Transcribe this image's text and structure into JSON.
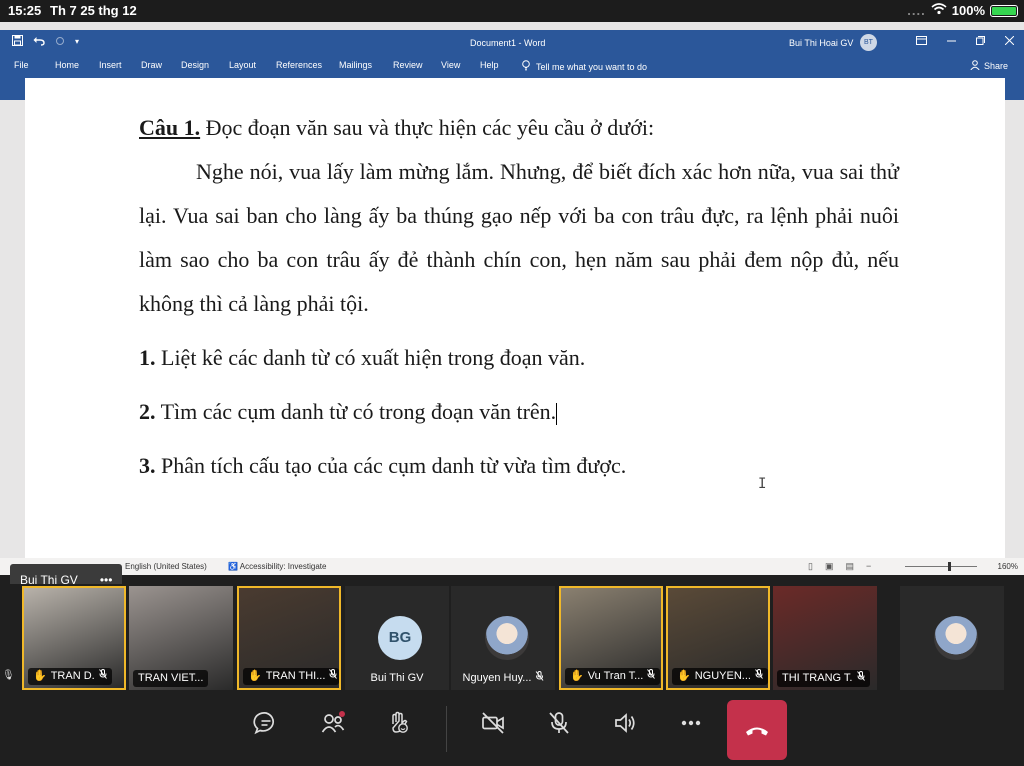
{
  "status_bar": {
    "time": "15:25",
    "date": "Th 7 25 thg 12",
    "dots": "....",
    "battery_percent": "100%"
  },
  "word": {
    "doc_title": "Document1 - Word",
    "user_name": "Bui Thi Hoai GV",
    "user_initials": "BT",
    "menu": [
      "File",
      "Home",
      "Insert",
      "Draw",
      "Design",
      "Layout",
      "References",
      "Mailings",
      "Review",
      "View",
      "Help"
    ],
    "tell_me": "Tell me what you want to do",
    "share": "Share",
    "document": {
      "heading_number": "Câu 1.",
      "heading_text": " Đọc đoạn văn sau và thực hiện các yêu cầu ở dưới:",
      "paragraph": "Nghe nói, vua lấy làm mừng lắm. Nhưng, để biết đích xác hơn nữa, vua sai thử lại. Vua sai ban cho làng ấy ba thúng gạo nếp với ba con trâu đực, ra lệnh phải nuôi làm sao cho ba con trâu ấy đẻ thành chín con, hẹn năm sau phải đem nộp đủ, nếu không thì cả làng phải tội.",
      "questions": [
        {
          "num": "1.",
          "text": " Liệt kê các danh từ có xuất hiện trong đoạn văn."
        },
        {
          "num": "2.",
          "text": " Tìm các cụm danh từ có trong đoạn văn trên."
        },
        {
          "num": "3.",
          "text": " Phân tích cấu tạo của các cụm danh từ vừa tìm được."
        }
      ]
    },
    "status": {
      "language": "English (United States)",
      "accessibility": "Accessibility: Investigate",
      "zoom": "160%",
      "zoom_level_fraction": 0.6
    }
  },
  "presenter_label": {
    "name": "Bui Thi GV",
    "more": "•••"
  },
  "participants": [
    {
      "name": "TRAN D.",
      "hand": true,
      "muted": true,
      "speaking": true,
      "bg": "#b8b2aa"
    },
    {
      "name": "TRAN VIET...",
      "hand": false,
      "muted": false,
      "speaking": false,
      "bg": "#9b9490"
    },
    {
      "name": "TRAN THI...",
      "hand": true,
      "muted": true,
      "speaking": true,
      "bg": "#4a3b30"
    },
    {
      "name": "Bui Thi GV",
      "initials": "BG",
      "avatar": true,
      "speaking": false
    },
    {
      "name": "Nguyen Huy...",
      "photo": true,
      "muted": true,
      "speaking": false
    },
    {
      "name": "Vu Tran T...",
      "hand": true,
      "muted": true,
      "speaking": true,
      "bg": "#8a8070"
    },
    {
      "name": "NGUYEN...",
      "hand": true,
      "muted": true,
      "speaking": true,
      "bg": "#5a4a38"
    },
    {
      "name": "THI TRANG T.",
      "hand": false,
      "muted": true,
      "speaking": false,
      "bg": "#6b2a28"
    },
    {
      "name": "",
      "photo": true,
      "speaking": false
    }
  ],
  "controls": {
    "chat": "chat-icon",
    "people": "people-icon",
    "raise_hand": "raise-hand-icon",
    "camera": "camera-off-icon",
    "mic": "mic-off-icon",
    "speaker": "speaker-icon",
    "more": "more-icon",
    "hangup": "hang-up-icon",
    "accent_red": "#c4314b",
    "speaking_border": "#f0b829"
  }
}
